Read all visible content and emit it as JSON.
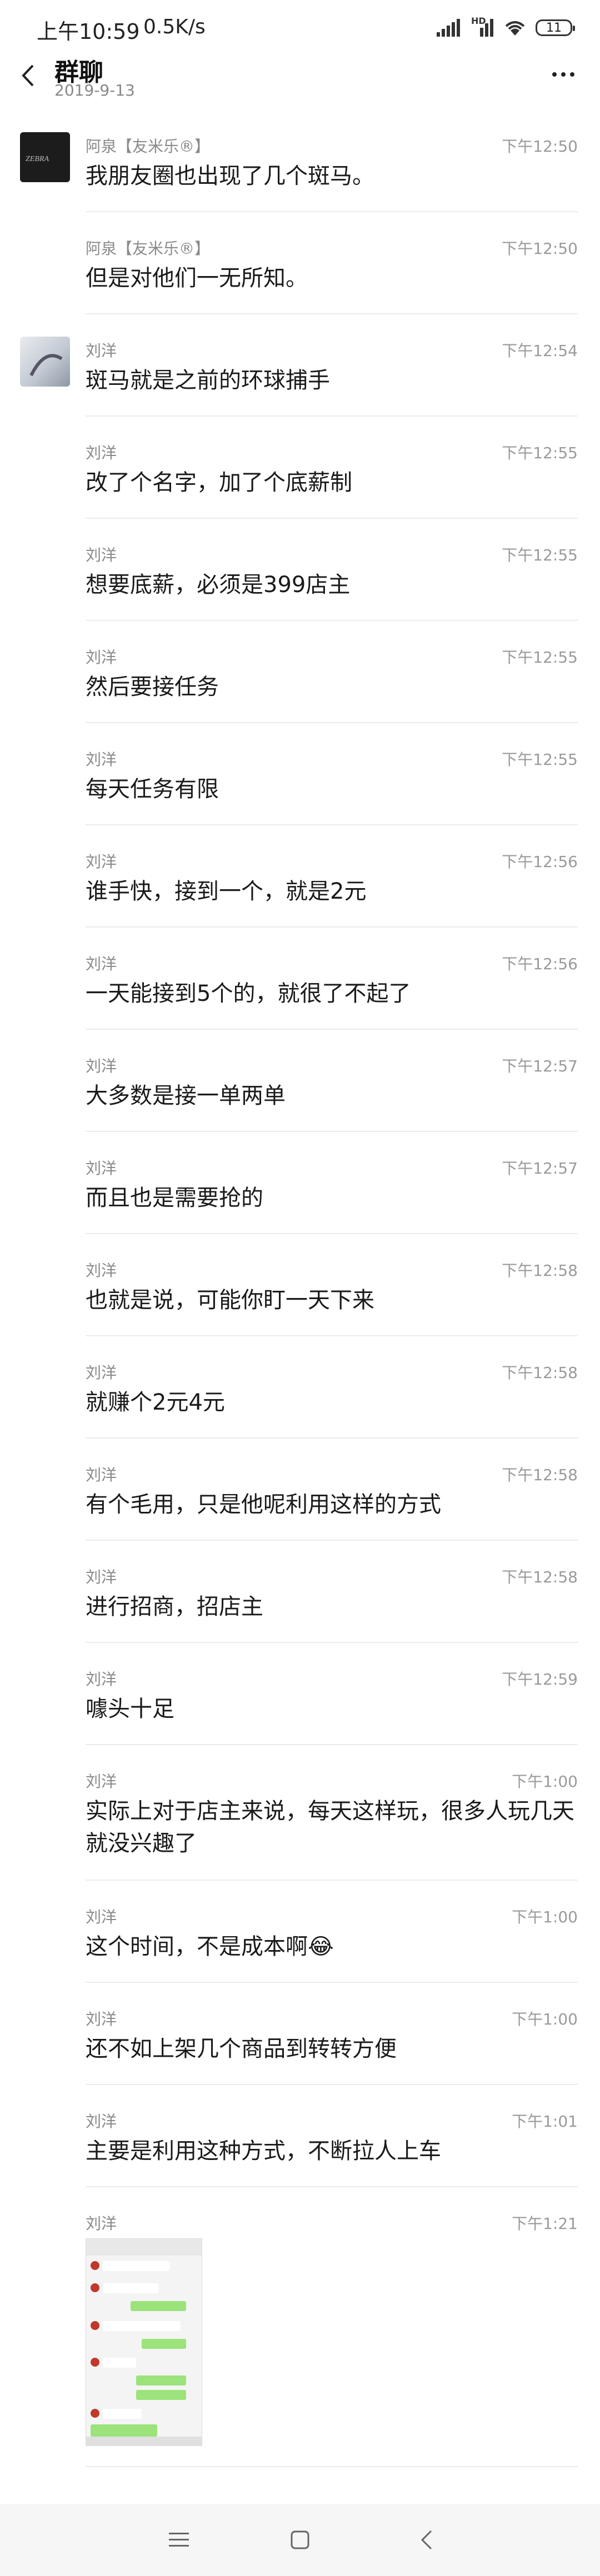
{
  "status": {
    "time": "上午10:59",
    "speed": "0.5K/s",
    "network": "HD",
    "battery": "11"
  },
  "header": {
    "title": "群聊",
    "date": "2019-9-13"
  },
  "messages": [
    {
      "sender": "阿泉【友米乐®】",
      "time": "下午12:50",
      "text": "我朋友圈也出现了几个斑马。"
    },
    {
      "sender": "阿泉【友米乐®】",
      "time": "下午12:50",
      "text": "但是对他们一无所知。"
    },
    {
      "sender": "刘洋",
      "time": "下午12:54",
      "text": "斑马就是之前的环球捕手"
    },
    {
      "sender": "刘洋",
      "time": "下午12:55",
      "text": "改了个名字，加了个底薪制"
    },
    {
      "sender": "刘洋",
      "time": "下午12:55",
      "text": "想要底薪，必须是399店主"
    },
    {
      "sender": "刘洋",
      "time": "下午12:55",
      "text": "然后要接任务"
    },
    {
      "sender": "刘洋",
      "time": "下午12:55",
      "text": "每天任务有限"
    },
    {
      "sender": "刘洋",
      "time": "下午12:56",
      "text": "谁手快，接到一个，就是2元"
    },
    {
      "sender": "刘洋",
      "time": "下午12:56",
      "text": "一天能接到5个的，就很了不起了"
    },
    {
      "sender": "刘洋",
      "time": "下午12:57",
      "text": "大多数是接一单两单"
    },
    {
      "sender": "刘洋",
      "time": "下午12:57",
      "text": "而且也是需要抢的"
    },
    {
      "sender": "刘洋",
      "time": "下午12:58",
      "text": "也就是说，可能你盯一天下来"
    },
    {
      "sender": "刘洋",
      "time": "下午12:58",
      "text": "就赚个2元4元"
    },
    {
      "sender": "刘洋",
      "time": "下午12:58",
      "text": "有个毛用，只是他呢利用这样的方式"
    },
    {
      "sender": "刘洋",
      "time": "下午12:58",
      "text": "进行招商，招店主"
    },
    {
      "sender": "刘洋",
      "time": "下午12:59",
      "text": "噱头十足"
    },
    {
      "sender": "刘洋",
      "time": "下午1:00",
      "text": "实际上对于店主来说，每天这样玩，很多人玩几天就没兴趣了"
    },
    {
      "sender": "刘洋",
      "time": "下午1:00",
      "text": "这个时间，不是成本啊",
      "emoji": "😂"
    },
    {
      "sender": "刘洋",
      "time": "下午1:00",
      "text": "还不如上架几个商品到转转方便"
    },
    {
      "sender": "刘洋",
      "time": "下午1:01",
      "text": "主要是利用这种方式，不断拉人上车"
    },
    {
      "sender": "刘洋",
      "time": "下午1:21",
      "image": "chat-screenshot-thumbnail"
    }
  ],
  "icons": {
    "back": "chevron-left-icon",
    "more": "more-dots-icon",
    "nav_menu": "menu-icon",
    "nav_home": "square-icon",
    "nav_back": "back-triangle-icon"
  }
}
